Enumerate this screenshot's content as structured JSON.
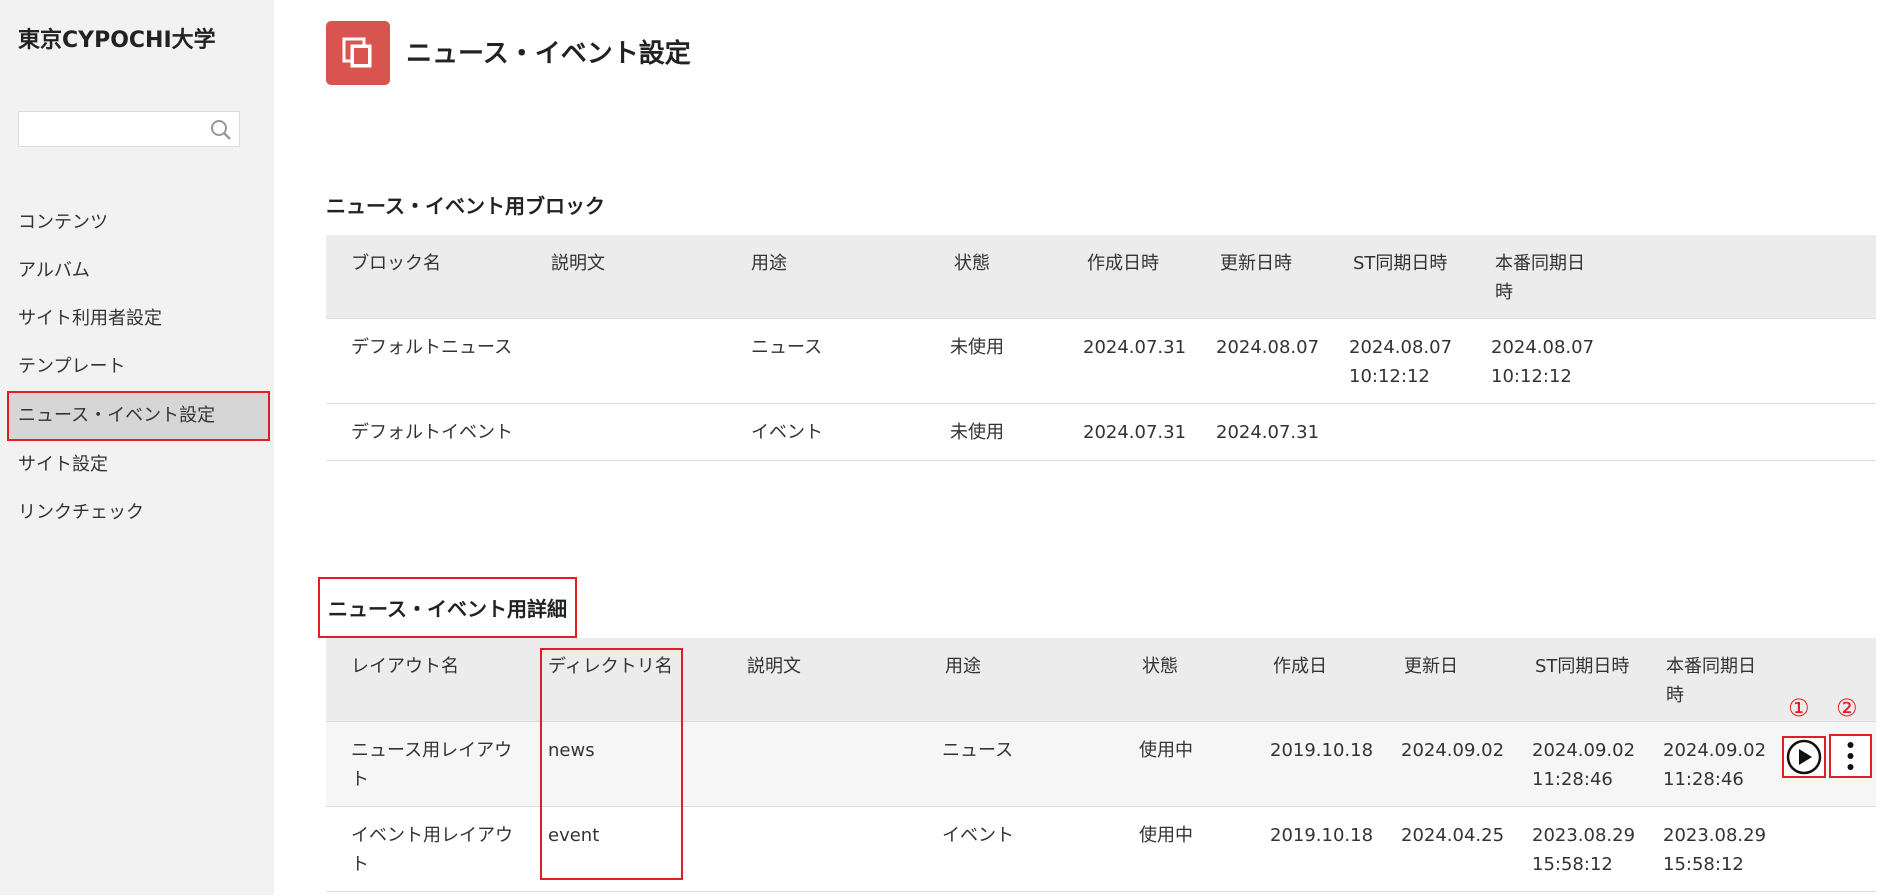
{
  "brand": "東京CYPOCHI大学",
  "search": {
    "placeholder": ""
  },
  "nav": [
    "コンテンツ",
    "アルバム",
    "サイト利用者設定",
    "テンプレート",
    "ニュース・イベント設定",
    "サイト設定",
    "リンクチェック"
  ],
  "active_nav_index": 4,
  "page_title": "ニュース・イベント設定",
  "section_blocks": {
    "title": "ニュース・イベント用ブロック",
    "headers": [
      "ブロック名",
      "説明文",
      "用途",
      "状態",
      "作成日時",
      "更新日時",
      "ST同期日時",
      "本番同期日時"
    ],
    "rows": [
      [
        "デフォルトニュース",
        "",
        "ニュース",
        "未使用",
        "2024.07.31",
        "2024.08.07",
        "2024.08.07 10:12:12",
        "2024.08.07 10:12:12"
      ],
      [
        "デフォルトイベント",
        "",
        "イベント",
        "未使用",
        "2024.07.31",
        "2024.07.31",
        "",
        ""
      ]
    ]
  },
  "section_details": {
    "title": "ニュース・イベント用詳細",
    "headers": [
      "レイアウト名",
      "ディレクトリ名",
      "説明文",
      "用途",
      "状態",
      "作成日",
      "更新日",
      "ST同期日時",
      "本番同期日時"
    ],
    "rows": [
      [
        "ニュース用レイアウト",
        "news",
        "",
        "ニュース",
        "使用中",
        "2019.10.18",
        "2024.09.02",
        "2024.09.02 11:28:46",
        "2024.09.02 11:28:46"
      ],
      [
        "イベント用レイアウト",
        "event",
        "",
        "イベント",
        "使用中",
        "2019.10.18",
        "2024.04.25",
        "2023.08.29 15:58:12",
        "2023.08.29 15:58:12"
      ]
    ]
  },
  "annotations": {
    "one": "①",
    "two": "②"
  },
  "colors": {
    "accent": "#d9534f",
    "highlight": "#e02020"
  },
  "icons": {
    "header": "layers-icon",
    "search": "search-icon",
    "play": "play-icon",
    "more": "more-vertical-icon"
  }
}
